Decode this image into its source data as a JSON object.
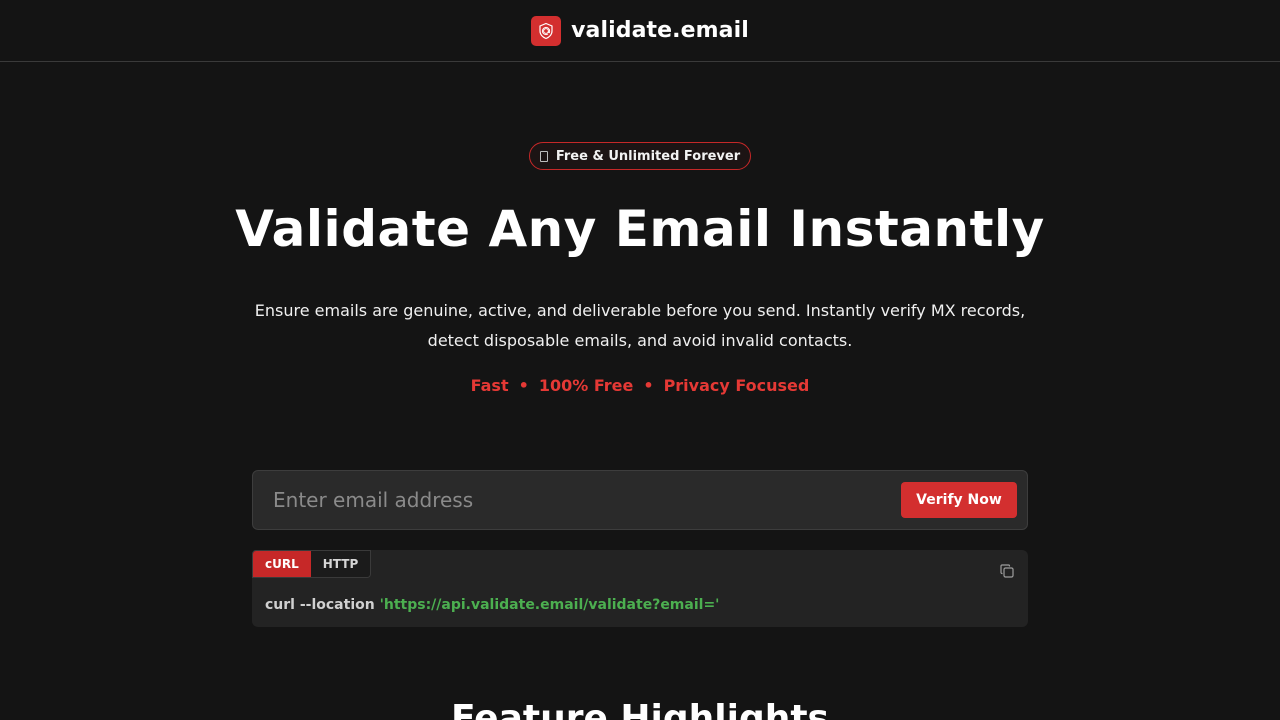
{
  "header": {
    "logo_icon": "shield-at-icon",
    "brand": "validate.email",
    "accent_color": "#d32f2f"
  },
  "hero": {
    "badge_icon": "phone-icon",
    "badge_text": "Free & Unlimited Forever",
    "title": "Validate Any Email Instantly",
    "subtitle": "Ensure emails are genuine, active, and deliverable before you send. Instantly verify MX records, detect disposable emails, and avoid invalid contacts.",
    "features": [
      "Fast",
      "100% Free",
      "Privacy Focused"
    ],
    "separator": "•"
  },
  "search": {
    "placeholder": "Enter email address",
    "value": "",
    "button_label": "Verify Now"
  },
  "code": {
    "tabs": [
      {
        "label": "cURL",
        "active": true
      },
      {
        "label": "HTTP",
        "active": false
      }
    ],
    "copy_icon": "copy-icon",
    "command": "curl --location",
    "url": "'https://api.validate.email/validate?email='"
  },
  "features_section": {
    "title": "Feature Highlights"
  }
}
